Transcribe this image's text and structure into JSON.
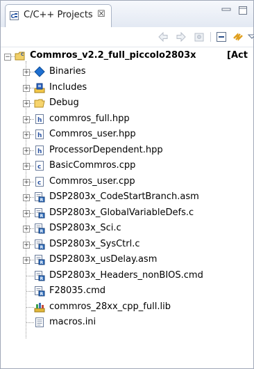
{
  "view": {
    "title": "C/C++ Projects",
    "close_glyph": "☒",
    "minimize_glyph": "▭",
    "maximize_glyph": "◻"
  },
  "toolbar": {
    "icons": [
      "back-icon",
      "forward-icon",
      "home-icon",
      "collapse-all-icon",
      "link-with-editor-icon",
      "view-menu-icon"
    ]
  },
  "tree": {
    "root": {
      "label": "Commros_v2.2_full_piccolo2803x",
      "suffix": "[Act",
      "expander": "⊟"
    },
    "items": [
      {
        "label": "Binaries",
        "icon": "binaries-icon",
        "expander": "+"
      },
      {
        "label": "Includes",
        "icon": "includes-icon",
        "expander": "+"
      },
      {
        "label": "Debug",
        "icon": "folder-icon",
        "expander": "+"
      },
      {
        "label": "commros_full.hpp",
        "icon": "header-file-icon",
        "expander": "+"
      },
      {
        "label": "Commros_user.hpp",
        "icon": "header-file-icon",
        "expander": "+"
      },
      {
        "label": "ProcessorDependent.hpp",
        "icon": "header-file-icon",
        "expander": "+"
      },
      {
        "label": "BasicCommros.cpp",
        "icon": "source-file-icon",
        "expander": "+"
      },
      {
        "label": "Commros_user.cpp",
        "icon": "source-file-icon",
        "expander": "+"
      },
      {
        "label": "DSP2803x_CodeStartBranch.asm",
        "icon": "linked-file-icon",
        "expander": "+"
      },
      {
        "label": "DSP2803x_GlobalVariableDefs.c",
        "icon": "linked-file-icon",
        "expander": "+"
      },
      {
        "label": "DSP2803x_Sci.c",
        "icon": "linked-file-icon",
        "expander": "+"
      },
      {
        "label": "DSP2803x_SysCtrl.c",
        "icon": "linked-file-icon",
        "expander": "+"
      },
      {
        "label": "DSP2803x_usDelay.asm",
        "icon": "linked-file-icon",
        "expander": "+"
      },
      {
        "label": "DSP2803x_Headers_nonBIOS.cmd",
        "icon": "linked-file-icon",
        "expander": ""
      },
      {
        "label": "F28035.cmd",
        "icon": "linked-file-icon",
        "expander": ""
      },
      {
        "label": "commros_28xx_cpp_full.lib",
        "icon": "library-icon",
        "expander": ""
      },
      {
        "label": "macros.ini",
        "icon": "text-file-icon",
        "expander": ""
      }
    ]
  },
  "colors": {
    "header_icon": "#3b6fb6",
    "source_icon": "#3b6fb6",
    "folder": "#f2c94c",
    "binaries": "#1e6fd0"
  }
}
